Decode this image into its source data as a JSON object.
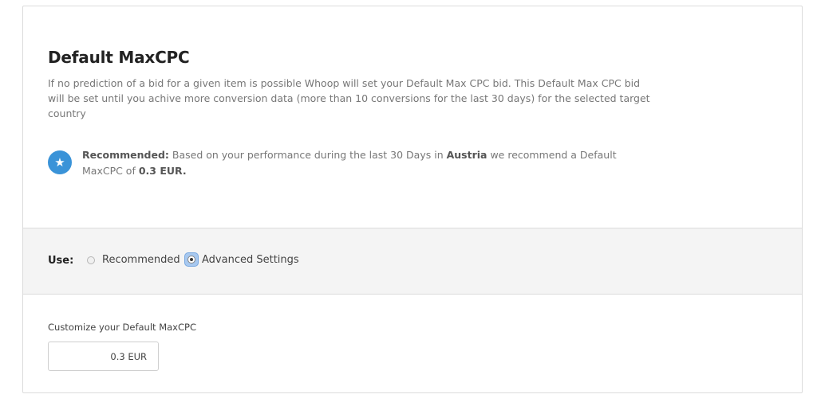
{
  "header": {
    "title": "Default MaxCPC",
    "description": "If no prediction of a bid for a given item is possible Whoop will set your Default Max CPC bid. This Default Max CPC bid will be set until you achive more conversion data (more than 10 conversions for the last 30 days) for the selected target country"
  },
  "recommendation": {
    "icon": "star-icon",
    "label": "Recommended:",
    "text_before_country": " Based on your performance during the last 30 Days in ",
    "country": "Austria",
    "text_after_country": " we recommend a Default MaxCPC of ",
    "value": "0.3 EUR."
  },
  "use": {
    "label": "Use:",
    "options": [
      {
        "label": "Recommended",
        "selected": false
      },
      {
        "label": "Advanced Settings",
        "selected": true
      }
    ]
  },
  "custom": {
    "label": "Customize your Default MaxCPC",
    "value": "0.3 EUR"
  },
  "colors": {
    "accent": "#3a93d8",
    "section_bg": "#f4f4f4",
    "border": "#dcdcdc"
  }
}
